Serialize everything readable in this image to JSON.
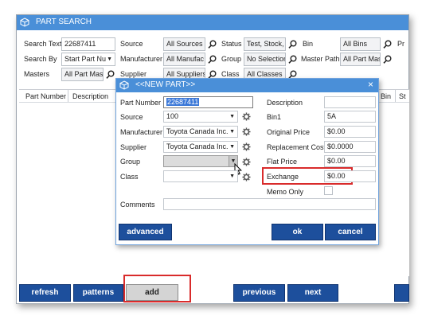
{
  "window": {
    "title": "PART SEARCH"
  },
  "filters": {
    "search_text_label": "Search Text",
    "search_text_value": "22687411",
    "search_by_label": "Search By",
    "search_by_value": "Start Part Nu",
    "masters_label": "Masters",
    "masters_value": "All Part Mast",
    "source_label": "Source",
    "source_value": "All Sources",
    "manufacturer_label": "Manufacturer",
    "manufacturer_value": "All Manufac",
    "supplier_label": "Supplier",
    "supplier_value": "All Suppliers",
    "status_label": "Status",
    "status_value": "Test, Stock, (",
    "group_label": "Group",
    "group_value": "No Selection",
    "class_label": "Class",
    "class_value": "All Classes",
    "bin_label": "Bin",
    "bin_value": "All Bins",
    "master_path_label": "Master Path",
    "master_path_value": "All Part Mas",
    "pr_label": "Pr"
  },
  "table": {
    "columns": [
      "Part Number",
      "Description",
      "Bin",
      "St"
    ]
  },
  "bottom_buttons": {
    "refresh": "refresh",
    "patterns": "patterns",
    "add": "add",
    "previous": "previous",
    "next": "next"
  },
  "dialog": {
    "title": "<<NEW PART>>",
    "close": "×",
    "part_number_label": "Part Number",
    "part_number_value": "22687411",
    "source_label": "Source",
    "source_value": "100",
    "manufacturer_label": "Manufacturer",
    "manufacturer_value": "Toyota Canada Inc.",
    "supplier_label": "Supplier",
    "supplier_value": "Toyota Canada Inc.",
    "group_label": "Group",
    "group_value": "",
    "class_label": "Class",
    "class_value": "",
    "comments_label": "Comments",
    "comments_value": "",
    "description_label": "Description",
    "description_value": "",
    "bin1_label": "Bin1",
    "bin1_value": "5A",
    "original_price_label": "Original Price",
    "original_price_value": "$0.00",
    "replacement_cost_label": "Replacement Cost",
    "replacement_cost_value": "$0.0000",
    "flat_price_label": "Flat Price",
    "flat_price_value": "$0.00",
    "exchange_label": "Exchange",
    "exchange_value": "$0.00",
    "memo_only_label": "Memo Only",
    "advanced": "advanced",
    "ok": "ok",
    "cancel": "cancel"
  },
  "colors": {
    "accent": "#4a8fd8",
    "button": "#1d4f9c",
    "highlight": "#d92b2b"
  }
}
